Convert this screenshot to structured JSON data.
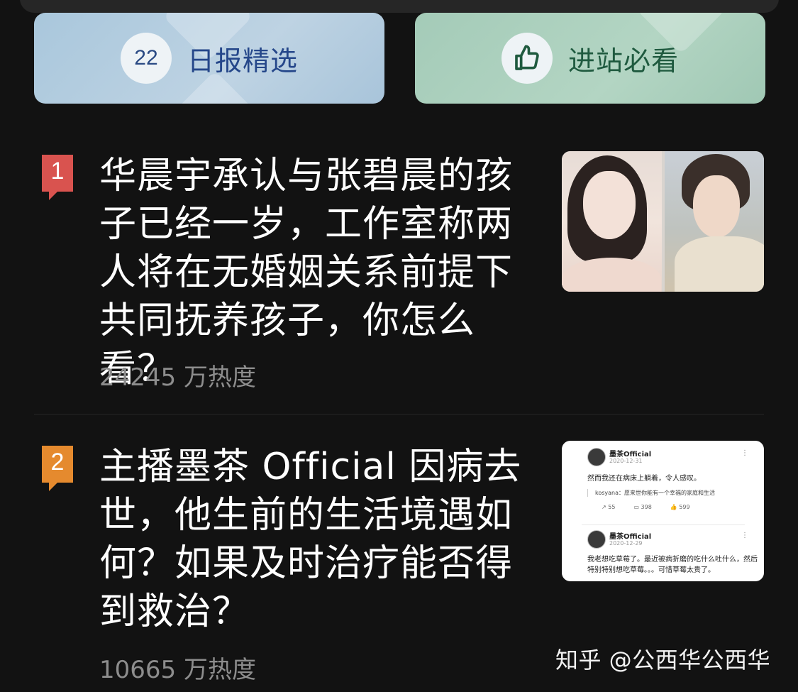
{
  "banners": {
    "daily": {
      "number": "22",
      "label": "日报精选"
    },
    "must_see": {
      "icon": "thumbs-up-icon",
      "label": "进站必看"
    }
  },
  "hot_list": [
    {
      "rank": "1",
      "title": "华晨宇承认与张碧晨的孩子已经一岁，工作室称两人将在无婚姻关系前提下共同抚养孩子，你怎么看？",
      "heat": "24245 万热度",
      "badge_color": "#d9534f"
    },
    {
      "rank": "2",
      "title": "主播墨茶 Official 因病去世，他生前的生活境遇如何？如果及时治疗能否得到救治？",
      "heat": "10665 万热度",
      "badge_color": "#e58a2e"
    }
  ],
  "thumb2": {
    "posts": [
      {
        "name": "墨茶Official",
        "date": "2020-12-31",
        "text": "然而我还在病床上躺着，令人感叹。",
        "comment": "kosyana：愿来世你能有一个幸福的家庭和生活",
        "shares": "55",
        "comments": "398",
        "likes": "599"
      },
      {
        "name": "墨茶Official",
        "date": "2020-12-29",
        "text": "我老想吃草莓了。最近被病折磨的吃什么吐什么，然后特别特别想吃草莓。。。可惜草莓太贵了。"
      }
    ]
  },
  "watermark": "知乎 @公西华公西华"
}
